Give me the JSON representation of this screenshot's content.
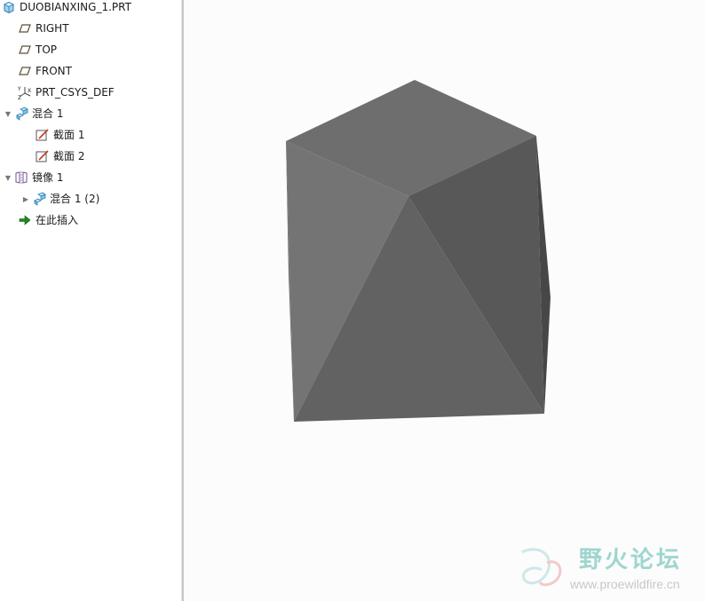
{
  "model_tree": {
    "root": {
      "label": "DUOBIANXING_1.PRT",
      "icon": "part-icon"
    },
    "items": [
      {
        "label": "RIGHT",
        "icon": "datum-plane-icon"
      },
      {
        "label": "TOP",
        "icon": "datum-plane-icon"
      },
      {
        "label": "FRONT",
        "icon": "datum-plane-icon"
      },
      {
        "label": "PRT_CSYS_DEF",
        "icon": "coordinate-system-icon"
      },
      {
        "label": "混合 1",
        "icon": "blend-feature-icon",
        "expanded": true
      },
      {
        "label": "截面 1",
        "icon": "sketch-icon"
      },
      {
        "label": "截面 2",
        "icon": "sketch-icon"
      },
      {
        "label": "镜像 1",
        "icon": "mirror-icon",
        "expanded": true
      },
      {
        "label": "混合 1 (2)",
        "icon": "blend-feature-icon",
        "expanded": false
      },
      {
        "label": "在此插入",
        "icon": "insert-here-arrow-icon"
      }
    ]
  },
  "viewport": {
    "model_color": "#6a6a6a"
  },
  "watermark": {
    "text_cn": "野火论坛",
    "url": "www.proewildfire.cn"
  }
}
